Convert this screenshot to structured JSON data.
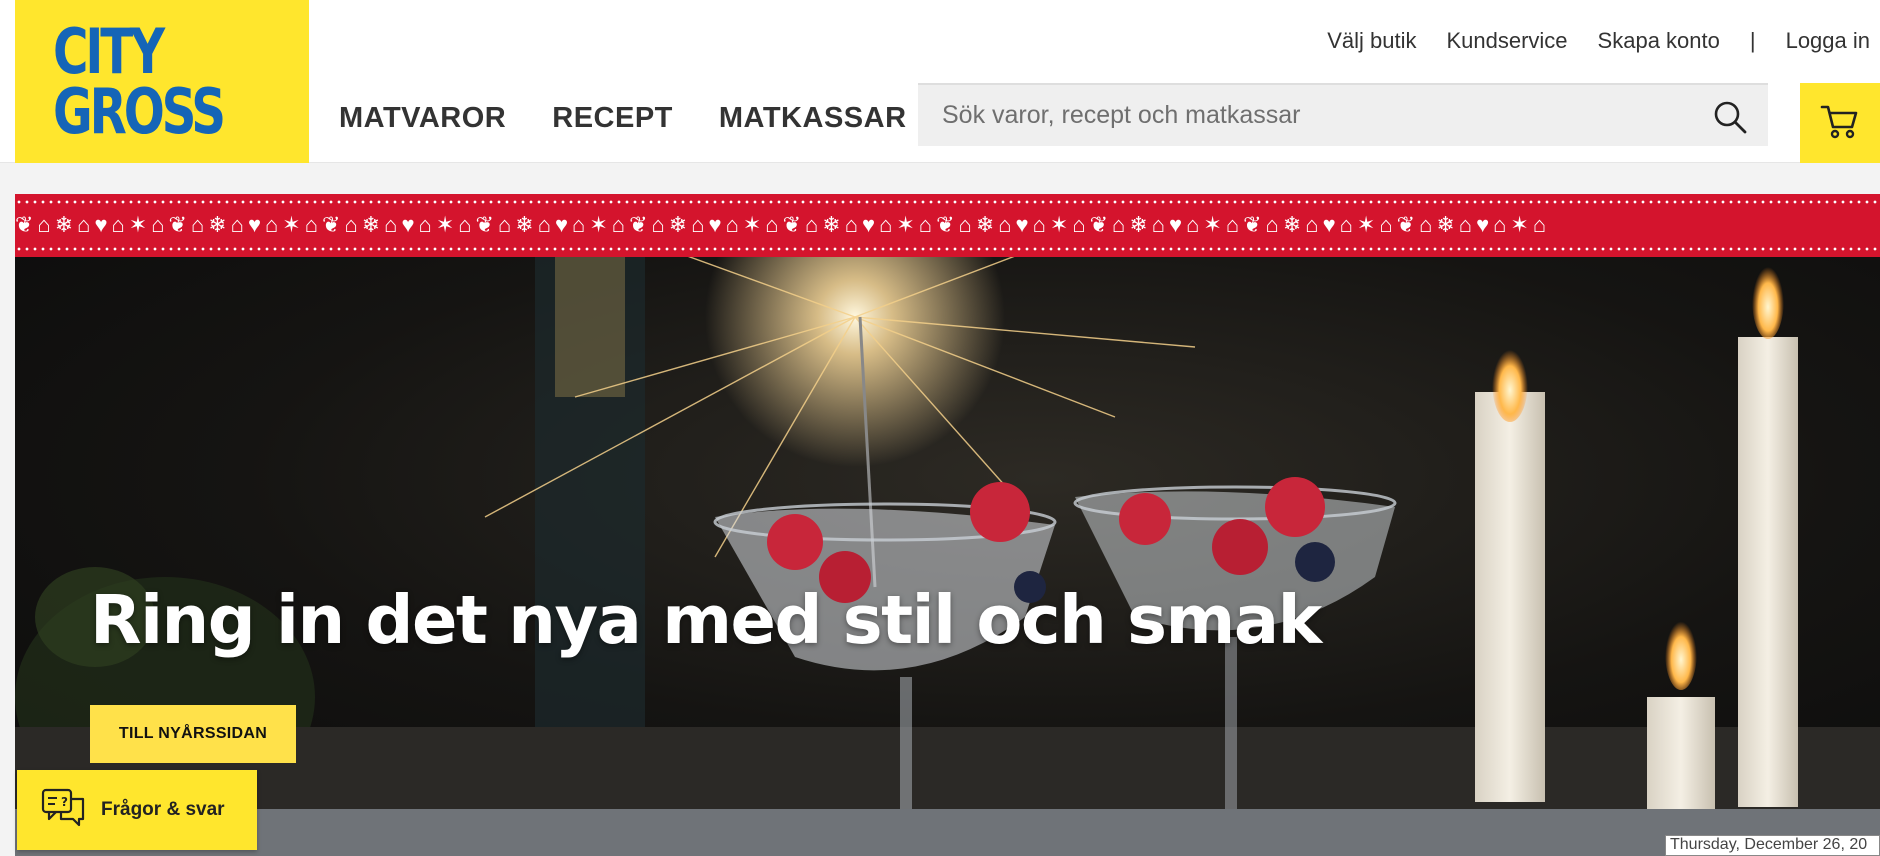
{
  "logo": {
    "line1": "CITY",
    "line2": "GROSS"
  },
  "top_links": {
    "choose_store": "Välj butik",
    "customer_service": "Kundservice",
    "create_account": "Skapa konto",
    "separator": "|",
    "login": "Logga in"
  },
  "nav": {
    "items": [
      {
        "label": "MATVAROR"
      },
      {
        "label": "RECEPT"
      },
      {
        "label": "MATKASSAR"
      }
    ]
  },
  "search": {
    "placeholder": "Sök varor, recept och matkassar",
    "value": ""
  },
  "icons": {
    "search": "search-icon",
    "cart": "cart-icon",
    "faq": "chat-question-icon"
  },
  "hero": {
    "title": "Ring in det nya med stil och smak",
    "button_label": "TILL NYÅRSSIDAN"
  },
  "faq": {
    "label": "Frågor & svar"
  },
  "status": {
    "date": "Thursday, December 26, 20"
  },
  "colors": {
    "brand_yellow": "#ffe62d",
    "brand_blue": "#1565b7",
    "festive_red": "#d4142d"
  }
}
